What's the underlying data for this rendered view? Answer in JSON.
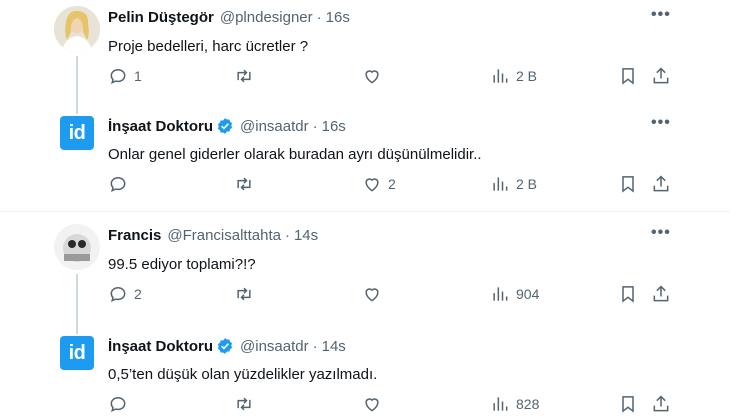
{
  "tweets": [
    {
      "name": "Pelin Düştegör",
      "handle": "@plndesigner",
      "time": "16s",
      "verified": false,
      "avatar": "photo",
      "text": "Proje bedelleri, harc ücretler ?",
      "replies": "1",
      "retweets": "",
      "likes": "",
      "views": "2 B"
    },
    {
      "name": "İnşaat Doktoru",
      "handle": "@insaatdr",
      "time": "16s",
      "verified": true,
      "avatar": "id",
      "text": "Onlar genel giderler olarak buradan ayrı düşünülmelidir..",
      "replies": "",
      "retweets": "",
      "likes": "2",
      "views": "2 B"
    },
    {
      "name": "Francis",
      "handle": "@Francisalttahta",
      "time": "14s",
      "verified": false,
      "avatar": "photo",
      "text": "99.5 ediyor toplami?!?",
      "replies": "2",
      "retweets": "",
      "likes": "",
      "views": "904"
    },
    {
      "name": "İnşaat Doktoru",
      "handle": "@insaatdr",
      "time": "14s",
      "verified": true,
      "avatar": "id",
      "text": "0,5’ten düşük olan yüzdelikler yazılmadı.",
      "replies": "",
      "retweets": "",
      "likes": "",
      "views": "828"
    }
  ],
  "dot_separator": "·",
  "more_glyph": "•••",
  "avatar_id_text": "id",
  "colors": {
    "accent": "#1d9bf0",
    "muted": "#536471",
    "text": "#0f1419",
    "thread_line": "#cfd9de"
  },
  "icons": [
    "reply-icon",
    "retweet-icon",
    "like-icon",
    "views-icon",
    "bookmark-icon",
    "share-icon",
    "verified-badge-icon",
    "more-icon"
  ]
}
